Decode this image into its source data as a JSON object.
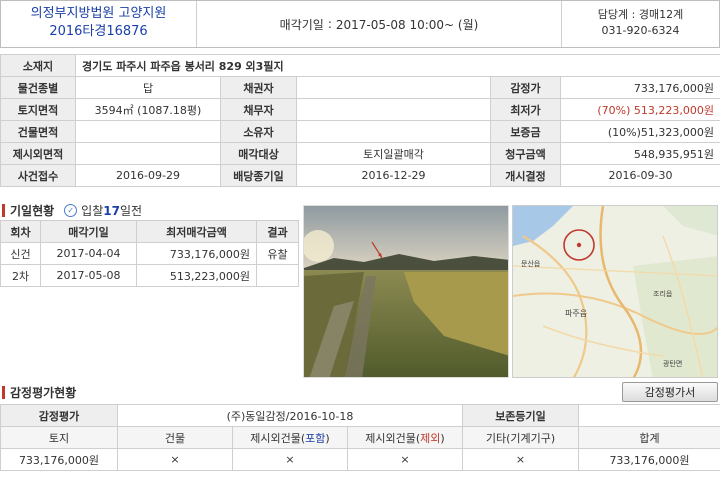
{
  "header": {
    "court_name": "의정부지방법원 고양지원",
    "case_number": "2016타경16876",
    "sale_label": "매각기일",
    "sale_datetime": "2017-05-08 10:00~ (월)",
    "dept": "담당계 : 경매12계",
    "phone": "031-920-6324"
  },
  "property": {
    "address_label": "소재지",
    "address": "경기도 파주시 파주읍 봉서리 829 외3필지",
    "rows": [
      {
        "l1": "물건종별",
        "v1": "답",
        "l2": "채권자",
        "v2": "",
        "l3": "감정가",
        "v3": "733,176,000원"
      },
      {
        "l1": "토지면적",
        "v1": "3594㎡ (1087.18평)",
        "l2": "채무자",
        "v2": "",
        "l3": "최저가",
        "v3": "(70%) 513,223,000원"
      },
      {
        "l1": "건물면적",
        "v1": "",
        "l2": "소유자",
        "v2": "",
        "l3": "보증금",
        "v3": "(10%)51,323,000원"
      },
      {
        "l1": "제시외면적",
        "v1": "",
        "l2": "매각대상",
        "v2": "토지일괄매각",
        "l3": "청구금액",
        "v3": "548,935,951원"
      },
      {
        "l1": "사건접수",
        "v1": "2016-09-29",
        "l2": "배당종기일",
        "v2": "2016-12-29",
        "l3": "개시결정",
        "v3": "2016-09-30"
      }
    ]
  },
  "history": {
    "title": "기일현황",
    "badge_prefix": "입찰",
    "badge_days": "17",
    "badge_suffix": "일전",
    "headers": [
      "회차",
      "매각기일",
      "최저매각금액",
      "결과"
    ],
    "rows": [
      {
        "round": "신건",
        "date": "2017-04-04",
        "amount": "733,176,000원",
        "result": "유찰"
      },
      {
        "round": "2차",
        "date": "2017-05-08",
        "amount": "513,223,000원",
        "result": ""
      }
    ]
  },
  "map": {
    "labels": [
      "파주읍",
      "문산읍",
      "조리읍",
      "광탄면"
    ]
  },
  "appraisal": {
    "title": "감정평가현황",
    "button_label": "감정평가서",
    "row1": {
      "l1": "감정평가",
      "v1": "(주)동일감정/2016-10-18",
      "l2": "보존등기일",
      "v2": ""
    },
    "headers": [
      "토지",
      "건물",
      "제시외건물(포함)",
      "제시외건물(제외)",
      "기타(기계기구)",
      "합계"
    ],
    "header_pre": "제시외건물(",
    "header_inc": "포함",
    "header_exc": "제외",
    "header_post": ")",
    "values": [
      "733,176,000원",
      "×",
      "×",
      "×",
      "×",
      "733,176,000원"
    ]
  },
  "colors": {
    "accent_blue": "#1a3fa8",
    "accent_red": "#c0392b"
  }
}
